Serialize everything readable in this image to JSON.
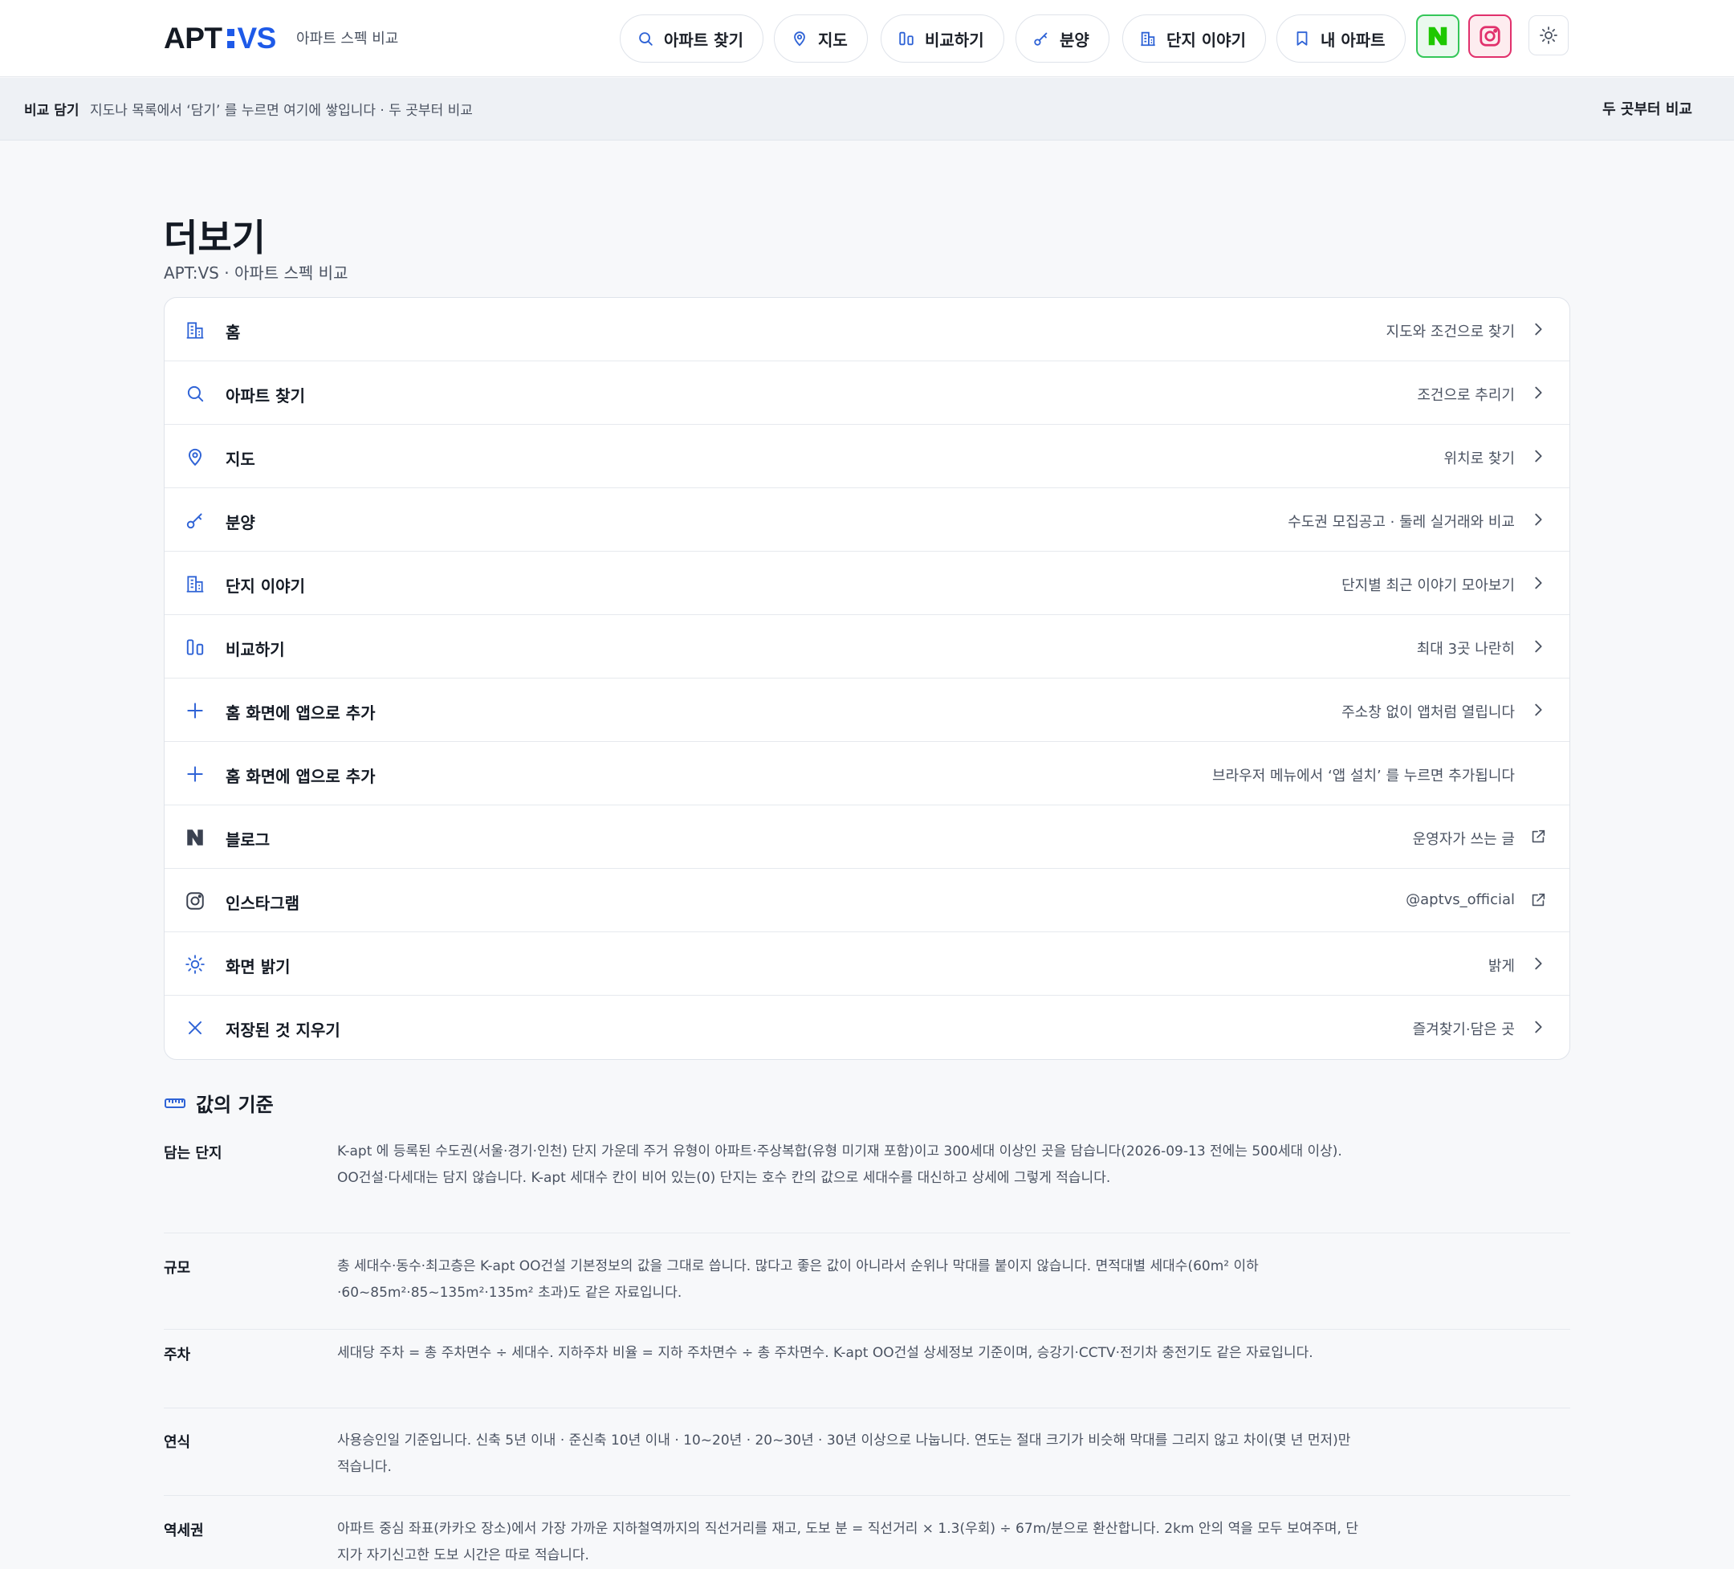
{
  "header": {
    "logo_apt": "APT",
    "logo_vs": "VS",
    "tagline": "아파트 스펙 비교",
    "nav": [
      {
        "label": "아파트 찾기",
        "icon": "search-icon"
      },
      {
        "label": "지도",
        "icon": "map-pin-icon"
      },
      {
        "label": "비교하기",
        "icon": "compare-icon"
      },
      {
        "label": "분양",
        "icon": "key-icon"
      },
      {
        "label": "단지 이야기",
        "icon": "building-icon"
      },
      {
        "label": "내 아파트",
        "icon": "bookmark-icon"
      }
    ],
    "naver_icon": "naver-icon",
    "instagram_icon": "instagram-icon",
    "theme_icon": "sun-icon"
  },
  "compare_bar": {
    "label": "비교 담기",
    "hint": "지도나 목록에서 ‘담기’ 를 누르면 여기에 쌓입니다 · 두 곳부터 비교",
    "right_label": "두 곳부터 비교"
  },
  "page": {
    "title": "더보기",
    "subtitle": "APT:VS · 아파트 스펙 비교"
  },
  "menu": [
    {
      "name": "홈",
      "desc": "지도와 조건으로 찾기",
      "icon": "building-icon",
      "arrow": "chevron-right-icon"
    },
    {
      "name": "아파트 찾기",
      "desc": "조건으로 추리기",
      "icon": "search-icon",
      "arrow": "chevron-right-icon"
    },
    {
      "name": "지도",
      "desc": "위치로 찾기",
      "icon": "map-pin-icon",
      "arrow": "chevron-right-icon"
    },
    {
      "name": "분양",
      "desc": "수도권 모집공고 · 둘레 실거래와 비교",
      "icon": "key-icon",
      "arrow": "chevron-right-icon"
    },
    {
      "name": "단지 이야기",
      "desc": "단지별 최근 이야기 모아보기",
      "icon": "building-icon",
      "arrow": "chevron-right-icon"
    },
    {
      "name": "비교하기",
      "desc": "최대 3곳 나란히",
      "icon": "compare-icon",
      "arrow": "chevron-right-icon"
    },
    {
      "name": "홈 화면에 앱으로 추가",
      "desc": "주소창 없이 앱처럼 열립니다",
      "icon": "plus-icon",
      "arrow": "chevron-right-icon"
    },
    {
      "name": "홈 화면에 앱으로 추가",
      "desc": "브라우저 메뉴에서 ‘앱 설치’ 를 누르면 추가됩니다",
      "icon": "plus-icon",
      "arrow": ""
    },
    {
      "name": "블로그",
      "desc": "운영자가 쓰는 글",
      "icon": "naver-icon",
      "arrow": "external-link-icon"
    },
    {
      "name": "인스타그램",
      "desc": "@aptvs_official",
      "icon": "instagram-icon",
      "arrow": "external-link-icon"
    },
    {
      "name": "화면 밝기",
      "desc": "밝게",
      "icon": "sun-icon",
      "arrow": "chevron-right-icon"
    },
    {
      "name": "저장된 것 지우기",
      "desc": "즐겨찾기·담은 곳",
      "icon": "close-icon",
      "arrow": "chevron-right-icon"
    }
  ],
  "criteria": {
    "title": "값의 기준",
    "icon": "ruler-icon",
    "items": [
      {
        "key": "담는 단지",
        "value": "K-apt 에 등록된 수도권(서울·경기·인천) 단지 가운데 주거 유형이 아파트·주상복합(유형 미기재 포함)이고 300세대 이상인 곳을 담습니다(2026-09-13 전에는 500세대 이상). OO건설·다세대는 담지 않습니다. K-apt 세대수 칸이 비어 있는(0) 단지는 호수 칸의 값으로 세대수를 대신하고 상세에 그렇게 적습니다."
      },
      {
        "key": "규모",
        "value": "총 세대수·동수·최고층은 K-apt OO건설 기본정보의 값을 그대로 씁니다. 많다고 좋은 값이 아니라서 순위나 막대를 붙이지 않습니다. 면적대별 세대수(60m² 이하·60~85m²·85~135m²·135m² 초과)도 같은 자료입니다."
      },
      {
        "key": "주차",
        "value": "세대당 주차 = 총 주차면수 ÷ 세대수. 지하주차 비율 = 지하 주차면수 ÷ 총 주차면수. K-apt OO건설 상세정보 기준이며, 승강기·CCTV·전기차 충전기도 같은 자료입니다."
      },
      {
        "key": "연식",
        "value": "사용승인일 기준입니다. 신축 5년 이내 · 준신축 10년 이내 · 10~20년 · 20~30년 · 30년 이상으로 나눕니다. 연도는 절대 크기가 비슷해 막대를 그리지 않고 차이(몇 년 먼저)만 적습니다."
      },
      {
        "key": "역세권",
        "value": "아파트 중심 좌표(카카오 장소)에서 가장 가까운 지하철역까지의 직선거리를 재고, 도보 분 = 직선거리 × 1.3(우회) ÷ 67m/분으로 환산합니다. 2km 안의 역을 모두 보여주며, 단지가 자기신고한 도보 시간은 따로 적습니다."
      }
    ]
  },
  "colors": {
    "accent": "#1e5ae8",
    "icon_blue": "#2f63d6",
    "naver_green": "#34c759",
    "insta_pink": "#e1306c"
  }
}
